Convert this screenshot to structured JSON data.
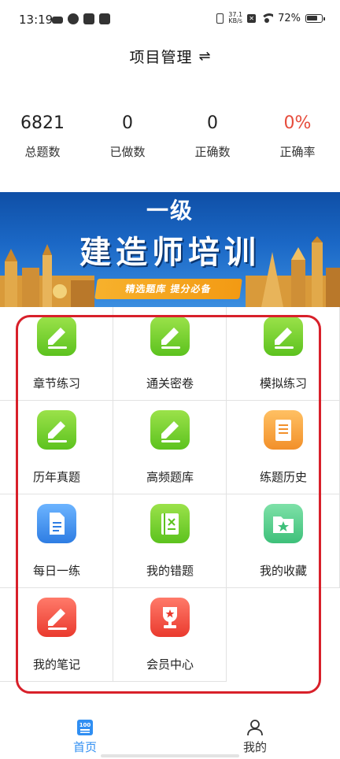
{
  "status_bar": {
    "time": "13:19",
    "net_speed_value": "37.1",
    "net_speed_unit": "KB/s",
    "battery": "72%"
  },
  "header": {
    "title": "项目管理",
    "switch_icon": "⇌"
  },
  "stats": [
    {
      "value": "6821",
      "label": "总题数"
    },
    {
      "value": "0",
      "label": "已做数"
    },
    {
      "value": "0",
      "label": "正确数"
    },
    {
      "value": "0%",
      "label": "正确率"
    }
  ],
  "banner": {
    "level": "一级",
    "title": "建造师培训",
    "ribbon": "精选题库  提分必备"
  },
  "menu": [
    {
      "label": "章节练习",
      "icon": "pencil-icon",
      "color": "#6ccc2a"
    },
    {
      "label": "通关密卷",
      "icon": "pencil-icon",
      "color": "#6ccc2a"
    },
    {
      "label": "模拟练习",
      "icon": "pencil-icon",
      "color": "#6ccc2a"
    },
    {
      "label": "历年真题",
      "icon": "pencil-icon",
      "color": "#6ccc2a"
    },
    {
      "label": "高频题库",
      "icon": "pencil-icon",
      "color": "#6ccc2a"
    },
    {
      "label": "练题历史",
      "icon": "scroll-icon",
      "color": "#f39a2a"
    },
    {
      "label": "每日一练",
      "icon": "document-icon",
      "color": "#3a8ce8"
    },
    {
      "label": "我的错题",
      "icon": "wrong-book-icon",
      "color": "#6ccc2a"
    },
    {
      "label": "我的收藏",
      "icon": "star-folder-icon",
      "color": "#4cc584"
    },
    {
      "label": "我的笔记",
      "icon": "pencil-icon",
      "color": "#f0463a"
    },
    {
      "label": "会员中心",
      "icon": "trophy-icon",
      "color": "#f0463a"
    }
  ],
  "bottom_nav": {
    "home": {
      "label": "首页",
      "icon_text": "100"
    },
    "mine": {
      "label": "我的"
    }
  },
  "colors": {
    "accent": "#2f8ef2",
    "highlight": "#d8202a",
    "rate": "#e64c3c"
  }
}
